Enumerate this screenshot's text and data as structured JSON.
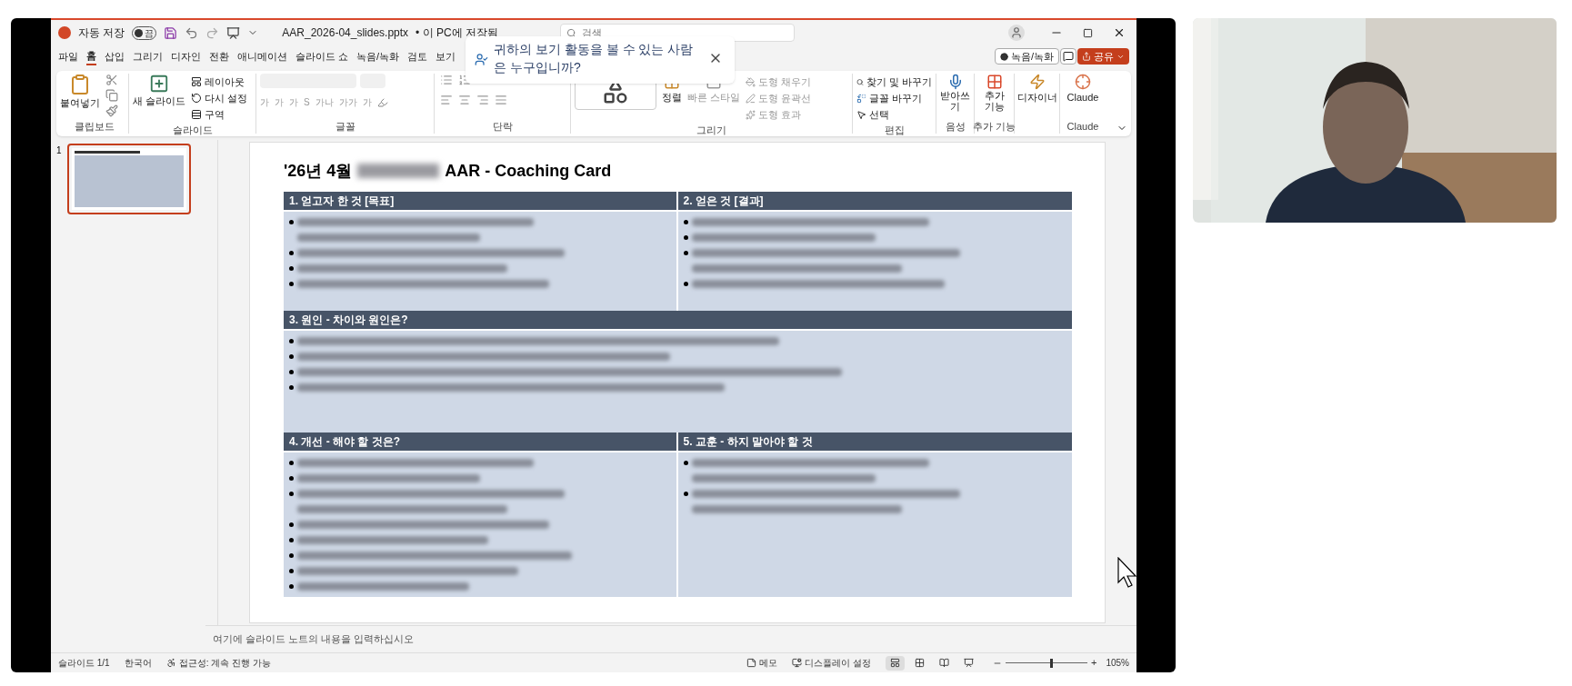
{
  "titlebar": {
    "autosave_label": "자동 저장",
    "autosave": {
      "on": false,
      "label": "끔"
    },
    "filename": "AAR_2026-04_slides.pptx",
    "save_status": "• 이 PC에 저장됨",
    "search": {
      "placeholder": "검색"
    }
  },
  "tabs": [
    {
      "label": "파일",
      "selected": false
    },
    {
      "label": "홈",
      "selected": true
    },
    {
      "label": "삽입",
      "selected": false
    },
    {
      "label": "그리기",
      "selected": false
    },
    {
      "label": "디자인",
      "selected": false
    },
    {
      "label": "전환",
      "selected": false
    },
    {
      "label": "애니메이션",
      "selected": false
    },
    {
      "label": "슬라이드 쇼",
      "selected": false
    },
    {
      "label": "녹음/녹화",
      "selected": false
    },
    {
      "label": "검토",
      "selected": false
    },
    {
      "label": "보기",
      "selected": false
    }
  ],
  "popup": {
    "text": "귀하의 보기 활동을 볼 수 있는 사람은 누구입니까?"
  },
  "top_buttons": {
    "record": "녹음/녹화",
    "share": "공유"
  },
  "ribbon": {
    "clipboard": {
      "label": "클립보드",
      "paste": "붙여넣기"
    },
    "slides": {
      "label": "슬라이드",
      "new_slide": "새 슬라이드",
      "items": [
        "레이아웃",
        "다시 설정",
        "구역"
      ]
    },
    "font": {
      "label": "글꼴",
      "glyphs": [
        "가",
        "가",
        "가",
        "S",
        "가나",
        "가가",
        "가"
      ]
    },
    "paragraph": {
      "label": "단락"
    },
    "drawing": {
      "label": "그리기",
      "arrange": "정렬",
      "quick_styles": "빠른 스타일",
      "items": [
        "도형 채우기",
        "도형 윤곽선",
        "도형 효과"
      ]
    },
    "editing": {
      "label": "편집",
      "items": [
        "찾기 및 바꾸기",
        "글꼴 바꾸기",
        "선택"
      ]
    },
    "voice": {
      "label": "음성",
      "button": "받아쓰기"
    },
    "addins": {
      "label": "추가 기능",
      "button": "추가 기능"
    },
    "designer": {
      "button": "디자이너"
    },
    "claude": {
      "label": "Claude",
      "button": "Claude"
    }
  },
  "thumbnails": [
    {
      "number": "1",
      "selected": true
    }
  ],
  "slide": {
    "title_start": "'26년 4월",
    "title_end": "AAR - Coaching Card",
    "sections": [
      {
        "heading": "1. 얻고자 한 것 [목표]",
        "lines": [
          {
            "bullet": true
          },
          {
            "bullet": false
          },
          {
            "bullet": true
          },
          {
            "bullet": true
          },
          {
            "bullet": true
          }
        ]
      },
      {
        "heading": "2. 얻은 것 [결과]",
        "lines": [
          {
            "bullet": true
          },
          {
            "bullet": true
          },
          {
            "bullet": true
          },
          {
            "bullet": false
          },
          {
            "bullet": true
          }
        ]
      },
      {
        "heading": "3. 원인 - 차이와 원인은?",
        "lines": [
          {
            "bullet": true
          },
          {
            "bullet": true
          },
          {
            "bullet": true
          },
          {
            "bullet": true
          }
        ]
      },
      {
        "heading": "4. 개선 - 해야 할 것은?",
        "lines": [
          {
            "bullet": true
          },
          {
            "bullet": true
          },
          {
            "bullet": true
          },
          {
            "bullet": false
          },
          {
            "bullet": true
          },
          {
            "bullet": true
          },
          {
            "bullet": true
          },
          {
            "bullet": true
          },
          {
            "bullet": true
          }
        ]
      },
      {
        "heading": "5. 교훈 - 하지 말아야 할 것",
        "lines": [
          {
            "bullet": true
          },
          {
            "bullet": false
          },
          {
            "bullet": true
          },
          {
            "bullet": false
          }
        ]
      }
    ]
  },
  "notes": {
    "placeholder": "여기에 슬라이드 노트의 내용을 입력하십시오"
  },
  "status_bar": {
    "slide": "슬라이드 1/1",
    "language": "한국어",
    "accessibility": "접근성: 계속 진행 가능",
    "notes": "메모",
    "display": "디스플레이 설정",
    "views": [
      {
        "selected": true
      },
      {
        "selected": false
      },
      {
        "selected": false
      },
      {
        "selected": false
      }
    ],
    "zoom": {
      "level": 0.55,
      "zoom_in": "+",
      "reading": "105%"
    }
  }
}
